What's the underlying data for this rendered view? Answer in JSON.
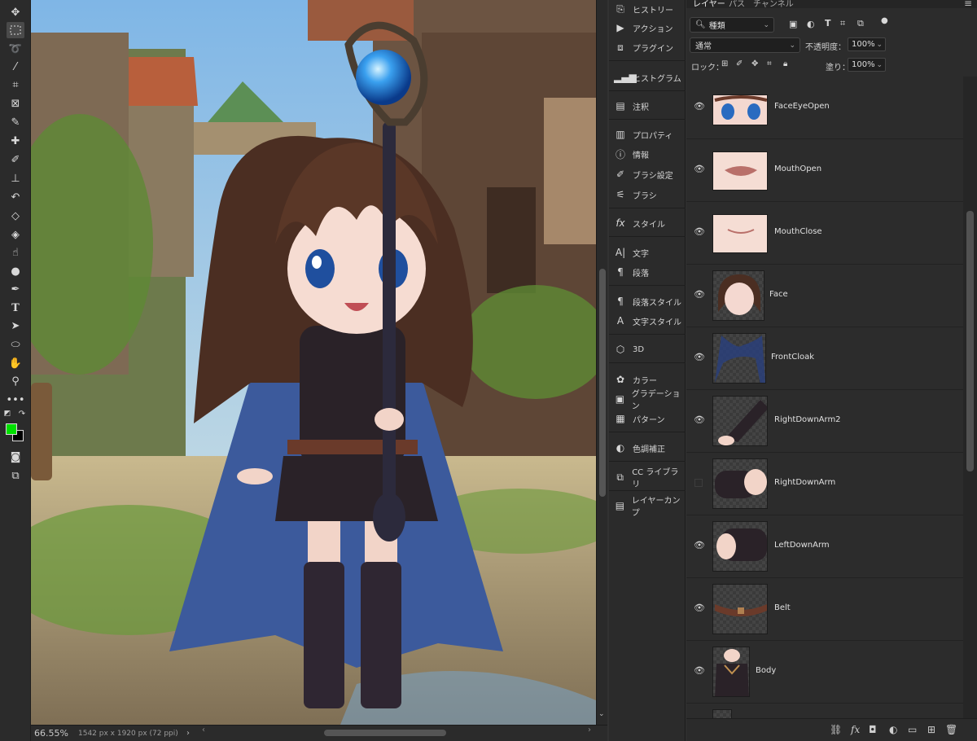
{
  "toolbar": {
    "tools": [
      "move-icon",
      "marquee-icon",
      "lasso-icon",
      "magic-wand-icon",
      "crop-icon",
      "frame-icon",
      "eyedropper-icon",
      "healing-brush-icon",
      "brush-icon",
      "stamp-icon",
      "history-brush-icon",
      "eraser-icon",
      "paint-bucket-icon",
      "smudge-icon",
      "dodge-icon",
      "pen-icon",
      "type-icon",
      "path-select-icon",
      "ellipse-icon",
      "hand-icon",
      "zoom-icon",
      "more-tools-icon"
    ],
    "foreground_color": "#00e000",
    "background_color": "#000000"
  },
  "status": {
    "zoom": "66.55%",
    "doc_info": "1542 px x 1920 px (72 ppi)"
  },
  "dock": {
    "items": [
      {
        "label": "ヒストリー",
        "icon": "history-icon"
      },
      {
        "label": "アクション",
        "icon": "actions-icon"
      },
      {
        "label": "プラグイン",
        "icon": "plugins-icon"
      },
      {
        "label": "ヒストグラム",
        "icon": "histogram-icon"
      },
      {
        "label": "注釈",
        "icon": "notes-icon"
      },
      {
        "label": "プロパティ",
        "icon": "properties-icon"
      },
      {
        "label": "情報",
        "icon": "info-icon"
      },
      {
        "label": "ブラシ設定",
        "icon": "brush-settings-icon"
      },
      {
        "label": "ブラシ",
        "icon": "brushes-icon"
      },
      {
        "label": "スタイル",
        "icon": "styles-icon"
      },
      {
        "label": "文字",
        "icon": "character-icon"
      },
      {
        "label": "段落",
        "icon": "paragraph-icon"
      },
      {
        "label": "段落スタイル",
        "icon": "paragraph-styles-icon"
      },
      {
        "label": "文字スタイル",
        "icon": "character-styles-icon"
      },
      {
        "label": "3D",
        "icon": "3d-icon"
      },
      {
        "label": "カラー",
        "icon": "color-icon"
      },
      {
        "label": "グラデーション",
        "icon": "gradients-icon"
      },
      {
        "label": "パターン",
        "icon": "patterns-icon"
      },
      {
        "label": "色調補正",
        "icon": "adjustments-icon"
      },
      {
        "label": "CC ライブラリ",
        "icon": "libraries-icon"
      },
      {
        "label": "レイヤーカンプ",
        "icon": "layer-comps-icon"
      }
    ]
  },
  "layers_panel": {
    "tabs": [
      "レイヤー",
      "パス",
      "チャンネル"
    ],
    "filter_kind": "種類",
    "blend_mode": "通常",
    "opacity_label": "不透明度：",
    "opacity_value": "100%",
    "lock_label": "ロック：",
    "fill_label": "塗り：",
    "fill_value": "100%",
    "layers": [
      {
        "name": "FaceEyeOpen",
        "visible": true
      },
      {
        "name": "MouthOpen",
        "visible": true
      },
      {
        "name": "MouthClose",
        "visible": true
      },
      {
        "name": "Face",
        "visible": true
      },
      {
        "name": "FrontCloak",
        "visible": true
      },
      {
        "name": "RightDownArm2",
        "visible": true
      },
      {
        "name": "RightDownArm",
        "visible": false
      },
      {
        "name": "LeftDownArm",
        "visible": true
      },
      {
        "name": "Belt",
        "visible": true
      },
      {
        "name": "Body",
        "visible": true
      }
    ]
  }
}
